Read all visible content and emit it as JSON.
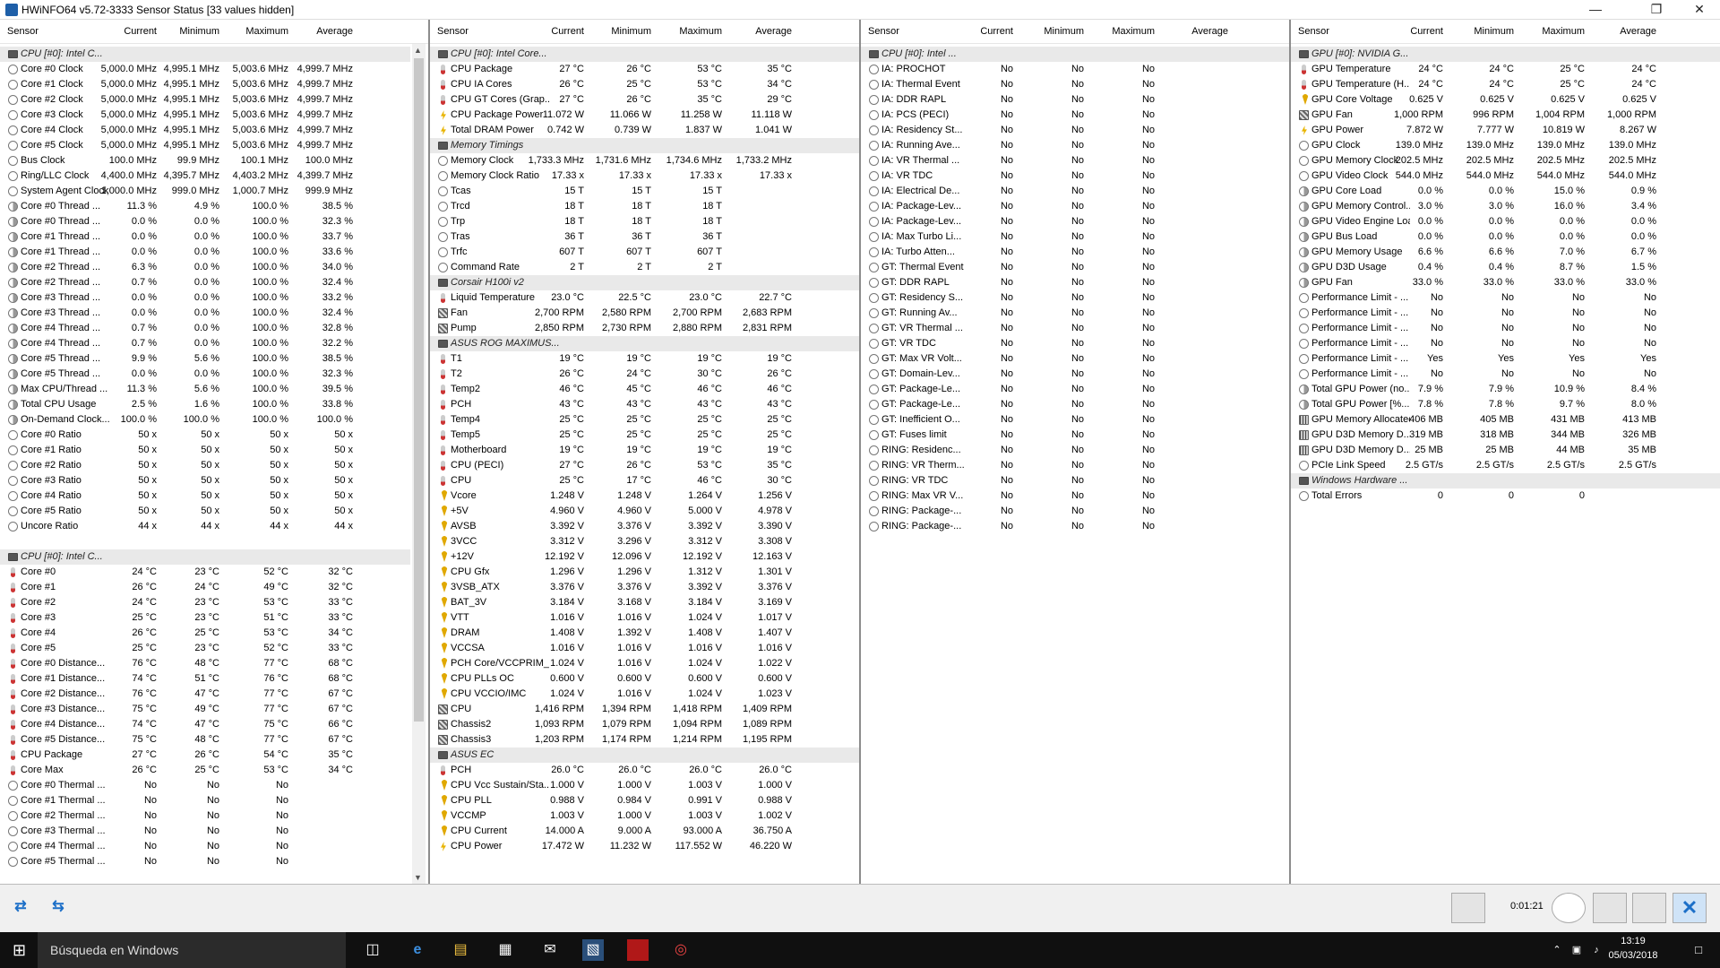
{
  "window": {
    "title": "HWiNFO64 v5.72-3333 Sensor Status [33 values hidden]"
  },
  "headers": [
    "Sensor",
    "Current",
    "Minimum",
    "Maximum",
    "Average"
  ],
  "p1": [
    [
      "g",
      "CPU [#0]: Intel C...",
      "",
      "",
      "",
      ""
    ],
    [
      "cl",
      "Core #0 Clock",
      "5,000.0 MHz",
      "4,995.1 MHz",
      "5,003.6 MHz",
      "4,999.7 MHz"
    ],
    [
      "cl",
      "Core #1 Clock",
      "5,000.0 MHz",
      "4,995.1 MHz",
      "5,003.6 MHz",
      "4,999.7 MHz"
    ],
    [
      "cl",
      "Core #2 Clock",
      "5,000.0 MHz",
      "4,995.1 MHz",
      "5,003.6 MHz",
      "4,999.7 MHz"
    ],
    [
      "cl",
      "Core #3 Clock",
      "5,000.0 MHz",
      "4,995.1 MHz",
      "5,003.6 MHz",
      "4,999.7 MHz"
    ],
    [
      "cl",
      "Core #4 Clock",
      "5,000.0 MHz",
      "4,995.1 MHz",
      "5,003.6 MHz",
      "4,999.7 MHz"
    ],
    [
      "cl",
      "Core #5 Clock",
      "5,000.0 MHz",
      "4,995.1 MHz",
      "5,003.6 MHz",
      "4,999.7 MHz"
    ],
    [
      "cl",
      "Bus Clock",
      "100.0 MHz",
      "99.9 MHz",
      "100.1 MHz",
      "100.0 MHz"
    ],
    [
      "cl",
      "Ring/LLC Clock",
      "4,400.0 MHz",
      "4,395.7 MHz",
      "4,403.2 MHz",
      "4,399.7 MHz"
    ],
    [
      "cl",
      "System Agent Clock",
      "1,000.0 MHz",
      "999.0 MHz",
      "1,000.7 MHz",
      "999.9 MHz"
    ],
    [
      "ut",
      "Core #0 Thread ...",
      "11.3 %",
      "4.9 %",
      "100.0 %",
      "38.5 %"
    ],
    [
      "ut",
      "Core #0 Thread ...",
      "0.0 %",
      "0.0 %",
      "100.0 %",
      "32.3 %"
    ],
    [
      "ut",
      "Core #1 Thread ...",
      "0.0 %",
      "0.0 %",
      "100.0 %",
      "33.7 %"
    ],
    [
      "ut",
      "Core #1 Thread ...",
      "0.0 %",
      "0.0 %",
      "100.0 %",
      "33.6 %"
    ],
    [
      "ut",
      "Core #2 Thread ...",
      "6.3 %",
      "0.0 %",
      "100.0 %",
      "34.0 %"
    ],
    [
      "ut",
      "Core #2 Thread ...",
      "0.7 %",
      "0.0 %",
      "100.0 %",
      "32.4 %"
    ],
    [
      "ut",
      "Core #3 Thread ...",
      "0.0 %",
      "0.0 %",
      "100.0 %",
      "33.2 %"
    ],
    [
      "ut",
      "Core #3 Thread ...",
      "0.0 %",
      "0.0 %",
      "100.0 %",
      "32.4 %"
    ],
    [
      "ut",
      "Core #4 Thread ...",
      "0.7 %",
      "0.0 %",
      "100.0 %",
      "32.8 %"
    ],
    [
      "ut",
      "Core #4 Thread ...",
      "0.7 %",
      "0.0 %",
      "100.0 %",
      "32.2 %"
    ],
    [
      "ut",
      "Core #5 Thread ...",
      "9.9 %",
      "5.6 %",
      "100.0 %",
      "38.5 %"
    ],
    [
      "ut",
      "Core #5 Thread ...",
      "0.0 %",
      "0.0 %",
      "100.0 %",
      "32.3 %"
    ],
    [
      "ut",
      "Max CPU/Thread ...",
      "11.3 %",
      "5.6 %",
      "100.0 %",
      "39.5 %"
    ],
    [
      "ut",
      "Total CPU Usage",
      "2.5 %",
      "1.6 %",
      "100.0 %",
      "33.8 %"
    ],
    [
      "ut",
      "On-Demand Clock...",
      "100.0 %",
      "100.0 %",
      "100.0 %",
      "100.0 %"
    ],
    [
      "cl",
      "Core #0 Ratio",
      "50 x",
      "50 x",
      "50 x",
      "50 x"
    ],
    [
      "cl",
      "Core #1 Ratio",
      "50 x",
      "50 x",
      "50 x",
      "50 x"
    ],
    [
      "cl",
      "Core #2 Ratio",
      "50 x",
      "50 x",
      "50 x",
      "50 x"
    ],
    [
      "cl",
      "Core #3 Ratio",
      "50 x",
      "50 x",
      "50 x",
      "50 x"
    ],
    [
      "cl",
      "Core #4 Ratio",
      "50 x",
      "50 x",
      "50 x",
      "50 x"
    ],
    [
      "cl",
      "Core #5 Ratio",
      "50 x",
      "50 x",
      "50 x",
      "50 x"
    ],
    [
      "cl",
      "Uncore Ratio",
      "44 x",
      "44 x",
      "44 x",
      "44 x"
    ],
    [
      "blank",
      "",
      "",
      "",
      "",
      ""
    ],
    [
      "g",
      "CPU [#0]: Intel C...",
      "",
      "",
      "",
      ""
    ],
    [
      "th",
      "Core #0",
      "24 °C",
      "23 °C",
      "52 °C",
      "32 °C"
    ],
    [
      "th",
      "Core #1",
      "26 °C",
      "24 °C",
      "49 °C",
      "32 °C"
    ],
    [
      "th",
      "Core #2",
      "24 °C",
      "23 °C",
      "53 °C",
      "33 °C"
    ],
    [
      "th",
      "Core #3",
      "25 °C",
      "23 °C",
      "51 °C",
      "33 °C"
    ],
    [
      "th",
      "Core #4",
      "26 °C",
      "25 °C",
      "53 °C",
      "34 °C"
    ],
    [
      "th",
      "Core #5",
      "25 °C",
      "23 °C",
      "52 °C",
      "33 °C"
    ],
    [
      "th",
      "Core #0 Distance...",
      "76 °C",
      "48 °C",
      "77 °C",
      "68 °C"
    ],
    [
      "th",
      "Core #1 Distance...",
      "74 °C",
      "51 °C",
      "76 °C",
      "68 °C"
    ],
    [
      "th",
      "Core #2 Distance...",
      "76 °C",
      "47 °C",
      "77 °C",
      "67 °C"
    ],
    [
      "th",
      "Core #3 Distance...",
      "75 °C",
      "49 °C",
      "77 °C",
      "67 °C"
    ],
    [
      "th",
      "Core #4 Distance...",
      "74 °C",
      "47 °C",
      "75 °C",
      "66 °C"
    ],
    [
      "th",
      "Core #5 Distance...",
      "75 °C",
      "48 °C",
      "77 °C",
      "67 °C"
    ],
    [
      "th",
      "CPU Package",
      "27 °C",
      "26 °C",
      "54 °C",
      "35 °C"
    ],
    [
      "th",
      "Core Max",
      "26 °C",
      "25 °C",
      "53 °C",
      "34 °C"
    ],
    [
      "yn",
      "Core #0 Thermal ...",
      "No",
      "No",
      "No",
      ""
    ],
    [
      "yn",
      "Core #1 Thermal ...",
      "No",
      "No",
      "No",
      ""
    ],
    [
      "yn",
      "Core #2 Thermal ...",
      "No",
      "No",
      "No",
      ""
    ],
    [
      "yn",
      "Core #3 Thermal ...",
      "No",
      "No",
      "No",
      ""
    ],
    [
      "yn",
      "Core #4 Thermal ...",
      "No",
      "No",
      "No",
      ""
    ],
    [
      "yn",
      "Core #5 Thermal ...",
      "No",
      "No",
      "No",
      ""
    ]
  ],
  "p2": [
    [
      "g",
      "CPU [#0]: Intel Core...",
      "",
      "",
      "",
      ""
    ],
    [
      "th",
      "CPU Package",
      "27 °C",
      "26 °C",
      "53 °C",
      "35 °C"
    ],
    [
      "th",
      "CPU IA Cores",
      "26 °C",
      "25 °C",
      "53 °C",
      "34 °C"
    ],
    [
      "th",
      "CPU GT Cores (Grap...",
      "27 °C",
      "26 °C",
      "35 °C",
      "29 °C"
    ],
    [
      "pw",
      "CPU Package Power",
      "11.072 W",
      "11.066 W",
      "11.258 W",
      "11.118 W"
    ],
    [
      "pw",
      "Total DRAM Power",
      "0.742 W",
      "0.739 W",
      "1.837 W",
      "1.041 W"
    ],
    [
      "g",
      "Memory Timings",
      "",
      "",
      "",
      ""
    ],
    [
      "cl",
      "Memory Clock",
      "1,733.3 MHz",
      "1,731.6 MHz",
      "1,734.6 MHz",
      "1,733.2 MHz"
    ],
    [
      "cl",
      "Memory Clock Ratio",
      "17.33 x",
      "17.33 x",
      "17.33 x",
      "17.33 x"
    ],
    [
      "cl",
      "Tcas",
      "15 T",
      "15 T",
      "15 T",
      ""
    ],
    [
      "cl",
      "Trcd",
      "18 T",
      "18 T",
      "18 T",
      ""
    ],
    [
      "cl",
      "Trp",
      "18 T",
      "18 T",
      "18 T",
      ""
    ],
    [
      "cl",
      "Tras",
      "36 T",
      "36 T",
      "36 T",
      ""
    ],
    [
      "cl",
      "Trfc",
      "607 T",
      "607 T",
      "607 T",
      ""
    ],
    [
      "cl",
      "Command Rate",
      "2 T",
      "2 T",
      "2 T",
      ""
    ],
    [
      "g",
      "Corsair H100i v2",
      "",
      "",
      "",
      ""
    ],
    [
      "th",
      "Liquid Temperature",
      "23.0 °C",
      "22.5 °C",
      "23.0 °C",
      "22.7 °C"
    ],
    [
      "fn",
      "Fan",
      "2,700 RPM",
      "2,580 RPM",
      "2,700 RPM",
      "2,683 RPM"
    ],
    [
      "fn",
      "Pump",
      "2,850 RPM",
      "2,730 RPM",
      "2,880 RPM",
      "2,831 RPM"
    ],
    [
      "g",
      "ASUS ROG MAXIMUS...",
      "",
      "",
      "",
      ""
    ],
    [
      "th",
      "T1",
      "19 °C",
      "19 °C",
      "19 °C",
      "19 °C"
    ],
    [
      "th",
      "T2",
      "26 °C",
      "24 °C",
      "30 °C",
      "26 °C"
    ],
    [
      "th",
      "Temp2",
      "46 °C",
      "45 °C",
      "46 °C",
      "46 °C"
    ],
    [
      "th",
      "PCH",
      "43 °C",
      "43 °C",
      "43 °C",
      "43 °C"
    ],
    [
      "th",
      "Temp4",
      "25 °C",
      "25 °C",
      "25 °C",
      "25 °C"
    ],
    [
      "th",
      "Temp5",
      "25 °C",
      "25 °C",
      "25 °C",
      "25 °C"
    ],
    [
      "th",
      "Motherboard",
      "19 °C",
      "19 °C",
      "19 °C",
      "19 °C"
    ],
    [
      "th",
      "CPU (PECI)",
      "27 °C",
      "26 °C",
      "53 °C",
      "35 °C"
    ],
    [
      "th",
      "CPU",
      "25 °C",
      "17 °C",
      "46 °C",
      "30 °C"
    ],
    [
      "vo",
      "Vcore",
      "1.248 V",
      "1.248 V",
      "1.264 V",
      "1.256 V"
    ],
    [
      "vo",
      "+5V",
      "4.960 V",
      "4.960 V",
      "5.000 V",
      "4.978 V"
    ],
    [
      "vo",
      "AVSB",
      "3.392 V",
      "3.376 V",
      "3.392 V",
      "3.390 V"
    ],
    [
      "vo",
      "3VCC",
      "3.312 V",
      "3.296 V",
      "3.312 V",
      "3.308 V"
    ],
    [
      "vo",
      "+12V",
      "12.192 V",
      "12.096 V",
      "12.192 V",
      "12.163 V"
    ],
    [
      "vo",
      "CPU Gfx",
      "1.296 V",
      "1.296 V",
      "1.312 V",
      "1.301 V"
    ],
    [
      "vo",
      "3VSB_ATX",
      "3.376 V",
      "3.376 V",
      "3.392 V",
      "3.376 V"
    ],
    [
      "vo",
      "BAT_3V",
      "3.184 V",
      "3.168 V",
      "3.184 V",
      "3.169 V"
    ],
    [
      "vo",
      "VTT",
      "1.016 V",
      "1.016 V",
      "1.024 V",
      "1.017 V"
    ],
    [
      "vo",
      "DRAM",
      "1.408 V",
      "1.392 V",
      "1.408 V",
      "1.407 V"
    ],
    [
      "vo",
      "VCCSA",
      "1.016 V",
      "1.016 V",
      "1.016 V",
      "1.016 V"
    ],
    [
      "vo",
      "PCH Core/VCCPRIM_...",
      "1.024 V",
      "1.016 V",
      "1.024 V",
      "1.022 V"
    ],
    [
      "vo",
      "CPU PLLs OC",
      "0.600 V",
      "0.600 V",
      "0.600 V",
      "0.600 V"
    ],
    [
      "vo",
      "CPU VCCIO/IMC",
      "1.024 V",
      "1.016 V",
      "1.024 V",
      "1.023 V"
    ],
    [
      "fn",
      "CPU",
      "1,416 RPM",
      "1,394 RPM",
      "1,418 RPM",
      "1,409 RPM"
    ],
    [
      "fn",
      "Chassis2",
      "1,093 RPM",
      "1,079 RPM",
      "1,094 RPM",
      "1,089 RPM"
    ],
    [
      "fn",
      "Chassis3",
      "1,203 RPM",
      "1,174 RPM",
      "1,214 RPM",
      "1,195 RPM"
    ],
    [
      "g",
      "ASUS EC",
      "",
      "",
      "",
      ""
    ],
    [
      "th",
      "PCH",
      "26.0 °C",
      "26.0 °C",
      "26.0 °C",
      "26.0 °C"
    ],
    [
      "vo",
      "CPU Vcc Sustain/Sta...",
      "1.000 V",
      "1.000 V",
      "1.003 V",
      "1.000 V"
    ],
    [
      "vo",
      "CPU PLL",
      "0.988 V",
      "0.984 V",
      "0.991 V",
      "0.988 V"
    ],
    [
      "vo",
      "VCCMP",
      "1.003 V",
      "1.000 V",
      "1.003 V",
      "1.002 V"
    ],
    [
      "vo",
      "CPU Current",
      "14.000 A",
      "9.000 A",
      "93.000 A",
      "36.750 A"
    ],
    [
      "pw",
      "CPU Power",
      "17.472 W",
      "11.232 W",
      "117.552 W",
      "46.220 W"
    ]
  ],
  "p3": [
    [
      "g",
      "CPU [#0]: Intel ...",
      "",
      "",
      "",
      ""
    ],
    [
      "yn",
      "IA: PROCHOT",
      "No",
      "No",
      "No",
      ""
    ],
    [
      "yn",
      "IA: Thermal Event",
      "No",
      "No",
      "No",
      ""
    ],
    [
      "yn",
      "IA: DDR RAPL",
      "No",
      "No",
      "No",
      ""
    ],
    [
      "yn",
      "IA: PCS (PECI)",
      "No",
      "No",
      "No",
      ""
    ],
    [
      "yn",
      "IA: Residency St...",
      "No",
      "No",
      "No",
      ""
    ],
    [
      "yn",
      "IA: Running Ave...",
      "No",
      "No",
      "No",
      ""
    ],
    [
      "yn",
      "IA: VR Thermal ...",
      "No",
      "No",
      "No",
      ""
    ],
    [
      "yn",
      "IA: VR TDC",
      "No",
      "No",
      "No",
      ""
    ],
    [
      "yn",
      "IA: Electrical De...",
      "No",
      "No",
      "No",
      ""
    ],
    [
      "yn",
      "IA: Package-Lev...",
      "No",
      "No",
      "No",
      ""
    ],
    [
      "yn",
      "IA: Package-Lev...",
      "No",
      "No",
      "No",
      ""
    ],
    [
      "yn",
      "IA: Max Turbo Li...",
      "No",
      "No",
      "No",
      ""
    ],
    [
      "yn",
      "IA: Turbo Atten...",
      "No",
      "No",
      "No",
      ""
    ],
    [
      "yn",
      "GT: Thermal Event",
      "No",
      "No",
      "No",
      ""
    ],
    [
      "yn",
      "GT: DDR RAPL",
      "No",
      "No",
      "No",
      ""
    ],
    [
      "yn",
      "GT: Residency S...",
      "No",
      "No",
      "No",
      ""
    ],
    [
      "yn",
      "GT: Running Av...",
      "No",
      "No",
      "No",
      ""
    ],
    [
      "yn",
      "GT: VR Thermal ...",
      "No",
      "No",
      "No",
      ""
    ],
    [
      "yn",
      "GT: VR TDC",
      "No",
      "No",
      "No",
      ""
    ],
    [
      "yn",
      "GT: Max VR Volt...",
      "No",
      "No",
      "No",
      ""
    ],
    [
      "yn",
      "GT: Domain-Lev...",
      "No",
      "No",
      "No",
      ""
    ],
    [
      "yn",
      "GT: Package-Le...",
      "No",
      "No",
      "No",
      ""
    ],
    [
      "yn",
      "GT: Package-Le...",
      "No",
      "No",
      "No",
      ""
    ],
    [
      "yn",
      "GT: Inefficient O...",
      "No",
      "No",
      "No",
      ""
    ],
    [
      "yn",
      "GT: Fuses limit",
      "No",
      "No",
      "No",
      ""
    ],
    [
      "yn",
      "RING: Residenc...",
      "No",
      "No",
      "No",
      ""
    ],
    [
      "yn",
      "RING: VR Therm...",
      "No",
      "No",
      "No",
      ""
    ],
    [
      "yn",
      "RING: VR TDC",
      "No",
      "No",
      "No",
      ""
    ],
    [
      "yn",
      "RING: Max VR V...",
      "No",
      "No",
      "No",
      ""
    ],
    [
      "yn",
      "RING: Package-...",
      "No",
      "No",
      "No",
      ""
    ],
    [
      "yn",
      "RING: Package-...",
      "No",
      "No",
      "No",
      ""
    ]
  ],
  "p4": [
    [
      "g",
      "GPU [#0]: NVIDIA G...",
      "",
      "",
      "",
      ""
    ],
    [
      "th",
      "GPU Temperature",
      "24 °C",
      "24 °C",
      "25 °C",
      "24 °C"
    ],
    [
      "th",
      "GPU Temperature (H...",
      "24 °C",
      "24 °C",
      "25 °C",
      "24 °C"
    ],
    [
      "vo",
      "GPU Core Voltage",
      "0.625 V",
      "0.625 V",
      "0.625 V",
      "0.625 V"
    ],
    [
      "fn",
      "GPU Fan",
      "1,000 RPM",
      "996 RPM",
      "1,004 RPM",
      "1,000 RPM"
    ],
    [
      "pw",
      "GPU Power",
      "7.872 W",
      "7.777 W",
      "10.819 W",
      "8.267 W"
    ],
    [
      "cl",
      "GPU Clock",
      "139.0 MHz",
      "139.0 MHz",
      "139.0 MHz",
      "139.0 MHz"
    ],
    [
      "cl",
      "GPU Memory Clock",
      "202.5 MHz",
      "202.5 MHz",
      "202.5 MHz",
      "202.5 MHz"
    ],
    [
      "cl",
      "GPU Video Clock",
      "544.0 MHz",
      "544.0 MHz",
      "544.0 MHz",
      "544.0 MHz"
    ],
    [
      "ut",
      "GPU Core Load",
      "0.0 %",
      "0.0 %",
      "15.0 %",
      "0.9 %"
    ],
    [
      "ut",
      "GPU Memory Control...",
      "3.0 %",
      "3.0 %",
      "16.0 %",
      "3.4 %"
    ],
    [
      "ut",
      "GPU Video Engine Load",
      "0.0 %",
      "0.0 %",
      "0.0 %",
      "0.0 %"
    ],
    [
      "ut",
      "GPU Bus Load",
      "0.0 %",
      "0.0 %",
      "0.0 %",
      "0.0 %"
    ],
    [
      "ut",
      "GPU Memory Usage",
      "6.6 %",
      "6.6 %",
      "7.0 %",
      "6.7 %"
    ],
    [
      "ut",
      "GPU D3D Usage",
      "0.4 %",
      "0.4 %",
      "8.7 %",
      "1.5 %"
    ],
    [
      "ut",
      "GPU Fan",
      "33.0 %",
      "33.0 %",
      "33.0 %",
      "33.0 %"
    ],
    [
      "yn",
      "Performance Limit - ...",
      "No",
      "No",
      "No",
      "No"
    ],
    [
      "yn",
      "Performance Limit - ...",
      "No",
      "No",
      "No",
      "No"
    ],
    [
      "yn",
      "Performance Limit - ...",
      "No",
      "No",
      "No",
      "No"
    ],
    [
      "yn",
      "Performance Limit - ...",
      "No",
      "No",
      "No",
      "No"
    ],
    [
      "yn",
      "Performance Limit - ...",
      "Yes",
      "Yes",
      "Yes",
      "Yes"
    ],
    [
      "yn",
      "Performance Limit - ...",
      "No",
      "No",
      "No",
      "No"
    ],
    [
      "ut",
      "Total GPU Power (no...",
      "7.9 %",
      "7.9 %",
      "10.9 %",
      "8.4 %"
    ],
    [
      "ut",
      "Total GPU Power [%...",
      "7.8 %",
      "7.8 %",
      "9.7 %",
      "8.0 %"
    ],
    [
      "cp",
      "GPU Memory Allocated",
      "406 MB",
      "405 MB",
      "431 MB",
      "413 MB"
    ],
    [
      "cp",
      "GPU D3D Memory D...",
      "319 MB",
      "318 MB",
      "344 MB",
      "326 MB"
    ],
    [
      "cp",
      "GPU D3D Memory D...",
      "25 MB",
      "25 MB",
      "44 MB",
      "35 MB"
    ],
    [
      "cl",
      "PCIe Link Speed",
      "2.5 GT/s",
      "2.5 GT/s",
      "2.5 GT/s",
      "2.5 GT/s"
    ],
    [
      "g",
      "Windows Hardware ...",
      "",
      "",
      "",
      ""
    ],
    [
      "yn",
      "Total Errors",
      "0",
      "0",
      "0",
      ""
    ]
  ],
  "bottom": {
    "timer": "0:01:21"
  },
  "taskbar": {
    "search": "Búsqueda en Windows",
    "time": "13:19",
    "date": "05/03/2018"
  }
}
